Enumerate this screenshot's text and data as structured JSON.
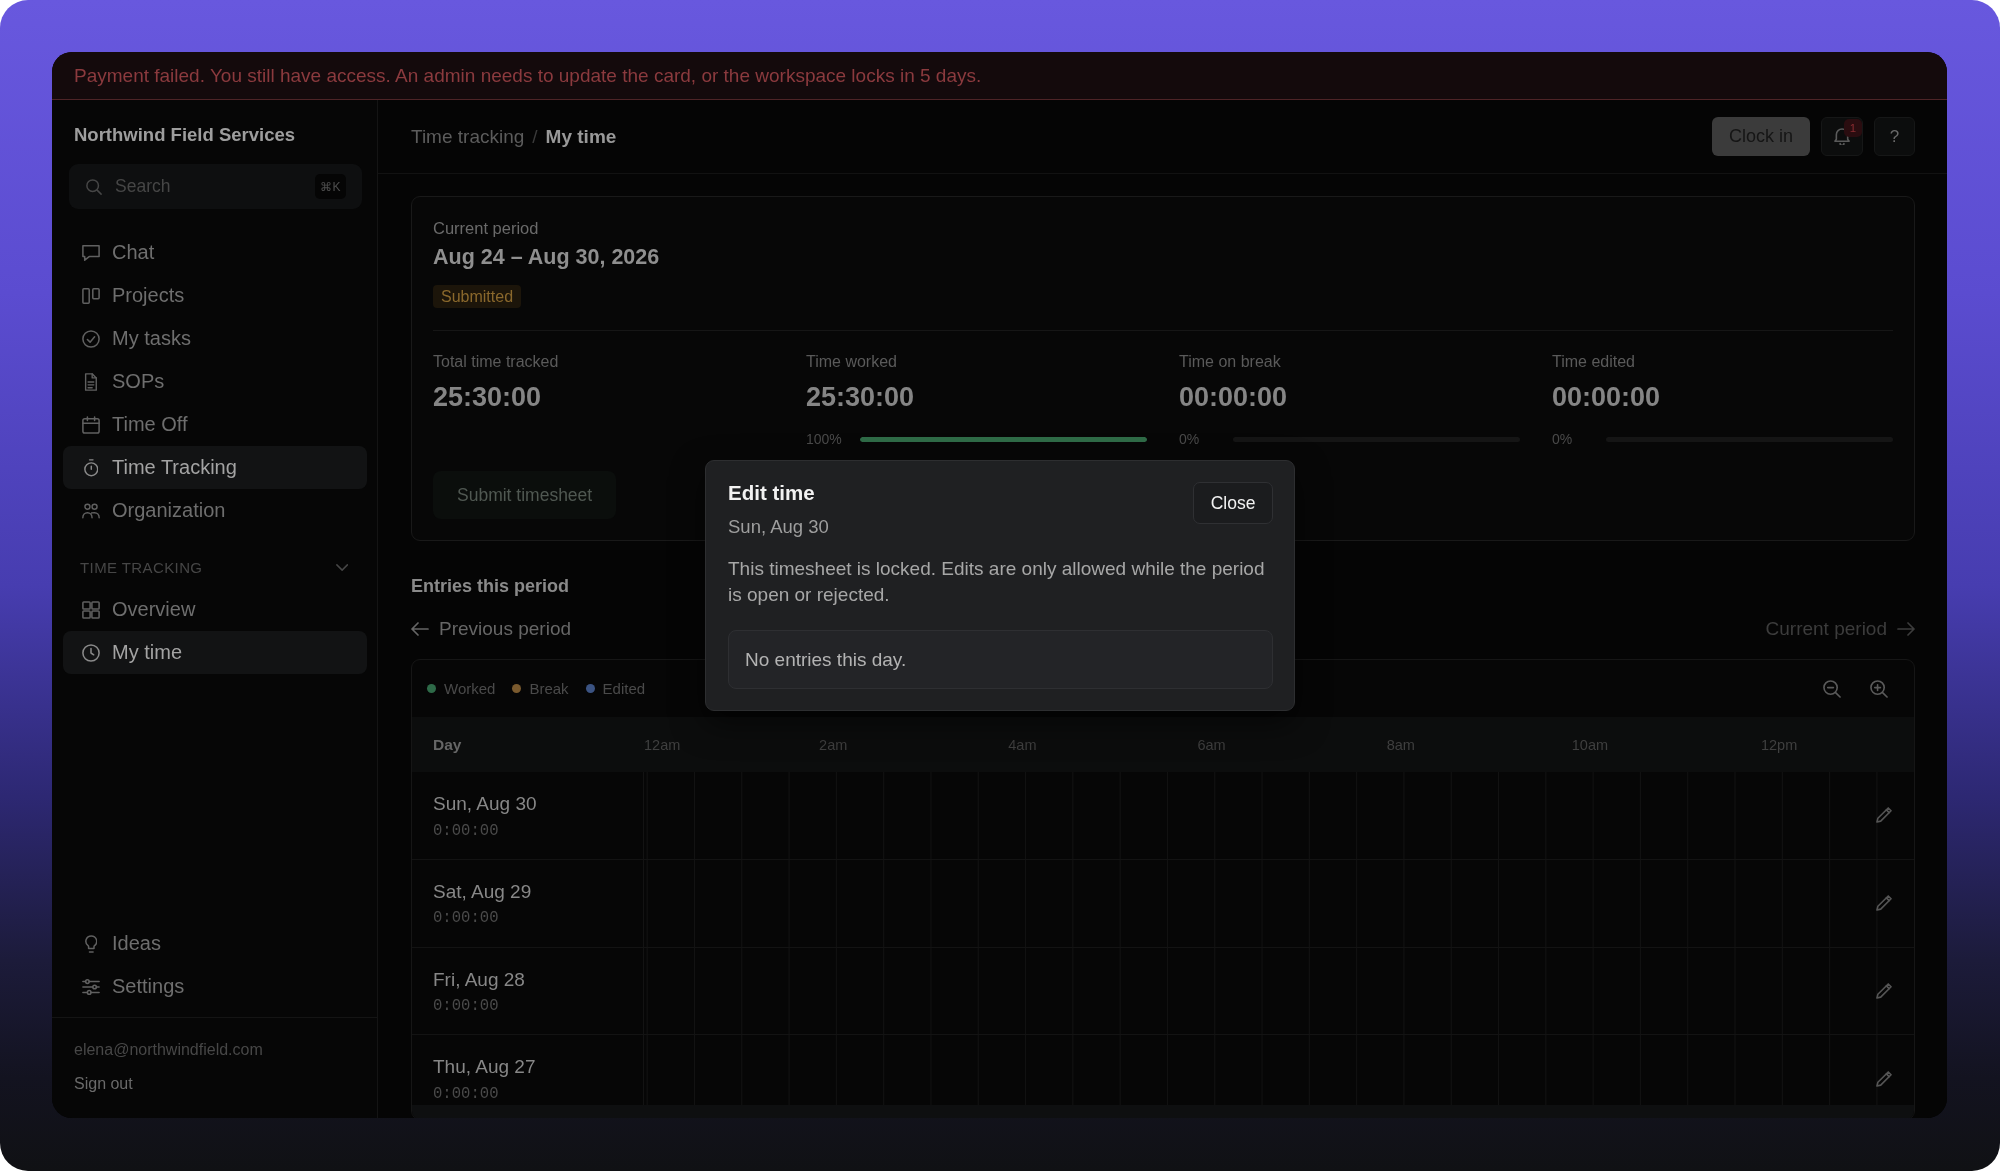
{
  "banner": {
    "message": "Payment failed. You still have access. An admin needs to update the card, or the workspace locks in 5 days."
  },
  "sidebar": {
    "workspace": "Northwind Field Services",
    "search": {
      "placeholder": "Search",
      "shortcut": "⌘K"
    },
    "items": [
      {
        "label": "Chat",
        "selected": false
      },
      {
        "label": "Projects",
        "selected": false
      },
      {
        "label": "My tasks",
        "selected": false
      },
      {
        "label": "SOPs",
        "selected": false
      },
      {
        "label": "Time Off",
        "selected": false
      },
      {
        "label": "Time Tracking",
        "selected": true
      },
      {
        "label": "Organization",
        "selected": false
      }
    ],
    "section": {
      "title": "TIME TRACKING",
      "expanded": true,
      "items": [
        {
          "label": "Overview",
          "selected": false
        },
        {
          "label": "My time",
          "selected": true
        }
      ]
    },
    "footer_items": [
      {
        "label": "Ideas",
        "selected": false
      },
      {
        "label": "Settings",
        "selected": false
      }
    ],
    "user": {
      "email": "elena@northwindfield.com",
      "sign_out": "Sign out"
    }
  },
  "header": {
    "breadcrumb": {
      "items": [
        "Time tracking",
        "My time"
      ],
      "separator": "/"
    },
    "clock_in": "Clock in",
    "notifications": {
      "count": "1"
    },
    "help": "?"
  },
  "period": {
    "label": "Current period",
    "range": "Aug 24 – Aug 30, 2026",
    "status": "Submitted",
    "stats": [
      {
        "kind": "total",
        "label": "Total time tracked",
        "value": "25:30:00"
      },
      {
        "kind": "meter",
        "label": "Time worked",
        "value": "25:30:00",
        "percent": "100%",
        "level": 1
      },
      {
        "kind": "meter",
        "label": "Time on break",
        "value": "00:00:00",
        "percent": "0%",
        "level": 0
      },
      {
        "kind": "meter",
        "label": "Time edited",
        "value": "00:00:00",
        "percent": "0%",
        "level": 0
      }
    ],
    "submit": {
      "label": "Submit timesheet",
      "disabled": true
    }
  },
  "entries": {
    "title": "Entries this period",
    "previous": {
      "label": "Previous period",
      "disabled": false
    },
    "next": {
      "label": "Current period",
      "disabled": true
    },
    "timeline": {
      "legend": [
        {
          "label": "Worked",
          "color": "#2e6a48"
        },
        {
          "label": "Break",
          "color": "#7a5a2e"
        },
        {
          "label": "Edited",
          "color": "#3b5382"
        }
      ],
      "day_column": "Day",
      "hours": [
        "12am",
        "2am",
        "4am",
        "6am",
        "8am",
        "10am",
        "12pm"
      ],
      "rows": [
        {
          "day": "Sun, Aug 30",
          "total": "0:00:00"
        },
        {
          "day": "Sat, Aug 29",
          "total": "0:00:00"
        },
        {
          "day": "Fri, Aug 28",
          "total": "0:00:00"
        },
        {
          "day": "Thu, Aug 27",
          "total": "0:00:00"
        }
      ]
    }
  },
  "dialog": {
    "title": "Edit time",
    "subtitle": "Sun, Aug 30",
    "close": "Close",
    "message": "This timesheet is locked. Edits are only allowed while the period is open or rejected.",
    "empty": "No entries this day."
  }
}
